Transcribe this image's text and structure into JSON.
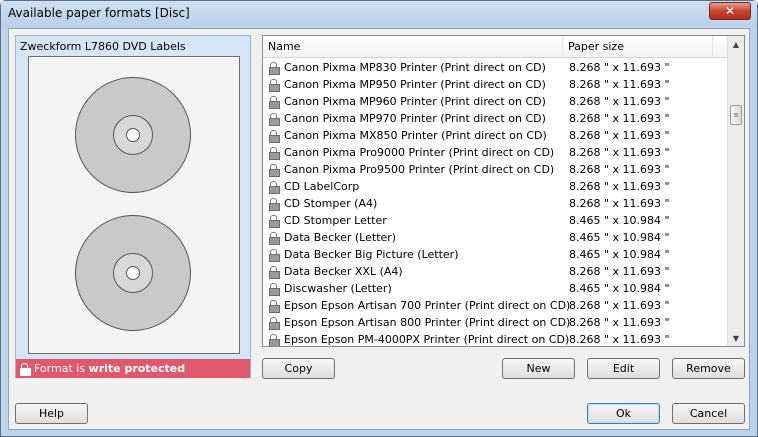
{
  "window": {
    "title": "Available paper formats [Disc]",
    "close_label": "✕"
  },
  "preview": {
    "title": "Zweckform L7860 DVD Labels",
    "status_prefix": "Format is",
    "status_emphasis": "write protected"
  },
  "list": {
    "columns": [
      "Name",
      "Paper size"
    ],
    "rows": [
      {
        "name": "Canon Pixma MP830 Printer (Print direct on CD)",
        "size": "8.268 \" x 11.693 \""
      },
      {
        "name": "Canon Pixma MP950 Printer (Print direct on CD)",
        "size": "8.268 \" x 11.693 \""
      },
      {
        "name": "Canon Pixma MP960 Printer (Print direct on CD)",
        "size": "8.268 \" x 11.693 \""
      },
      {
        "name": "Canon Pixma MP970 Printer (Print direct on CD)",
        "size": "8.268 \" x 11.693 \""
      },
      {
        "name": "Canon Pixma MX850 Printer (Print direct on CD)",
        "size": "8.268 \" x 11.693 \""
      },
      {
        "name": "Canon Pixma Pro9000 Printer (Print direct on CD)",
        "size": "8.268 \" x 11.693 \""
      },
      {
        "name": "Canon Pixma Pro9500 Printer (Print direct on CD)",
        "size": "8.268 \" x 11.693 \""
      },
      {
        "name": "CD LabelCorp",
        "size": "8.268 \" x 11.693 \""
      },
      {
        "name": "CD Stomper (A4)",
        "size": "8.268 \" x 11.693 \""
      },
      {
        "name": "CD Stomper Letter",
        "size": "8.465 \" x 10.984 \""
      },
      {
        "name": "Data Becker (Letter)",
        "size": "8.465 \" x 10.984 \""
      },
      {
        "name": "Data Becker Big Picture (Letter)",
        "size": "8.465 \" x 10.984 \""
      },
      {
        "name": "Data Becker XXL (A4)",
        "size": "8.268 \" x 11.693 \""
      },
      {
        "name": "Discwasher (Letter)",
        "size": "8.465 \" x 10.984 \""
      },
      {
        "name": "Epson Epson Artisan 700 Printer (Print direct on CD)",
        "size": "8.268 \" x 11.693 \""
      },
      {
        "name": "Epson Epson Artisan 800 Printer (Print direct on CD)",
        "size": "8.268 \" x 11.693 \""
      },
      {
        "name": "Epson Epson PM-4000PX Printer (Print direct on CD)",
        "size": "8.268 \" x 11.693 \""
      }
    ]
  },
  "buttons": {
    "copy": "Copy",
    "new": "New",
    "edit": "Edit",
    "remove": "Remove",
    "help": "Help",
    "ok": "Ok",
    "cancel": "Cancel"
  },
  "colors": {
    "protect_bar": "#e0586b",
    "panel": "#d6e6f7",
    "title_bar": "#bcd3ea"
  }
}
